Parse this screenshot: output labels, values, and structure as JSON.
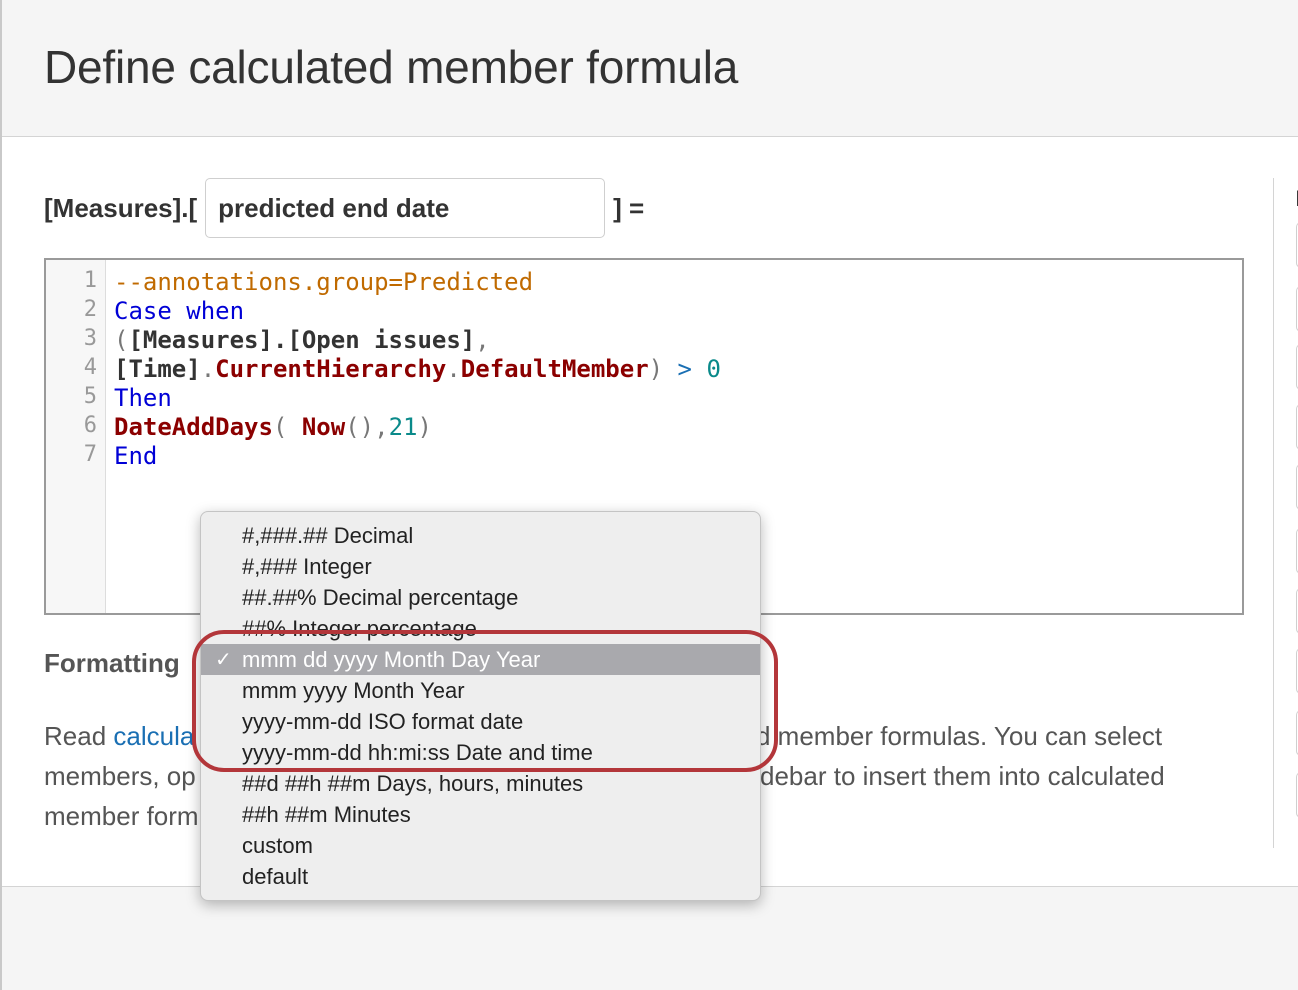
{
  "dialog": {
    "title": "Define calculated member formula"
  },
  "name_field": {
    "prefix": "[Measures].[",
    "value": "predicted end date",
    "suffix": "] ="
  },
  "editor": {
    "line_numbers": [
      "1",
      "2",
      "3",
      "4",
      "5",
      "6",
      "7"
    ],
    "lines": [
      [
        {
          "t": "--annotations.group=Predicted",
          "c": "anno"
        }
      ],
      [
        {
          "t": "Case when",
          "c": "kw"
        }
      ],
      [
        {
          "t": "(",
          "c": "punc"
        },
        {
          "t": "[Measures].[Open issues]",
          "c": "member"
        },
        {
          "t": ",",
          "c": "punc"
        }
      ],
      [
        {
          "t": "[Time]",
          "c": "member"
        },
        {
          "t": ".",
          "c": "punc"
        },
        {
          "t": "CurrentHierarchy",
          "c": "fn"
        },
        {
          "t": ".",
          "c": "punc"
        },
        {
          "t": "DefaultMember",
          "c": "fn"
        },
        {
          "t": ") ",
          "c": "punc"
        },
        {
          "t": ">",
          "c": "op"
        },
        {
          "t": " 0",
          "c": "num"
        }
      ],
      [
        {
          "t": "Then",
          "c": "kw"
        }
      ],
      [
        {
          "t": "DateAddDays",
          "c": "fn"
        },
        {
          "t": "( ",
          "c": "punc"
        },
        {
          "t": "Now",
          "c": "fn"
        },
        {
          "t": "(),",
          "c": "punc"
        },
        {
          "t": "21",
          "c": "num"
        },
        {
          "t": ")",
          "c": "punc"
        }
      ],
      [
        {
          "t": "End",
          "c": "kw"
        }
      ]
    ]
  },
  "formatting": {
    "label": "Formatting"
  },
  "help": {
    "line1_start": "Read ",
    "line1_link": "calcula",
    "line1_end": "d member formulas. You can select",
    "line2_start": "members, op",
    "line2_end": "debar to insert them into calculated",
    "line3_start": "member form"
  },
  "side_panel": {
    "label_fragment": "I"
  },
  "dropdown": {
    "check_mark": "✓",
    "selected_index": 4,
    "options": [
      "#,###.## Decimal",
      "#,### Integer",
      "##.##% Decimal percentage",
      "##% Integer percentage",
      "mmm dd yyyy Month Day Year",
      "mmm yyyy Month Year",
      "yyyy-mm-dd ISO format date",
      "yyyy-mm-dd hh:mi:ss Date and time",
      "##d ##h ##m Days, hours, minutes",
      "##h ##m Minutes",
      "custom",
      "default"
    ]
  }
}
